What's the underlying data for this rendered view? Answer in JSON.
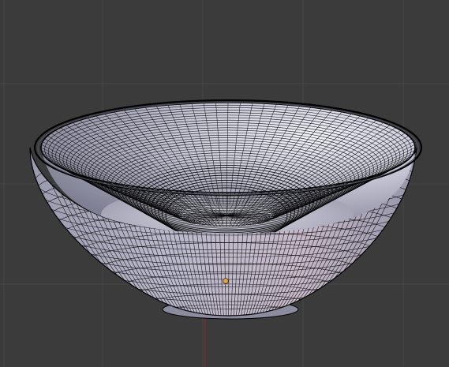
{
  "viewport": {
    "editor": "3d-view",
    "background_color": "#3b3b3b",
    "grid_line_color": "#474747",
    "axis_color": "#8a2b2b",
    "grid_visible": true
  },
  "object": {
    "name": "bowl-mesh",
    "shading": "solid",
    "edit_mode_wire": true,
    "surface_color": "#b7b7cc",
    "wire_color": "#000000",
    "origin_color": "#e2a144"
  }
}
